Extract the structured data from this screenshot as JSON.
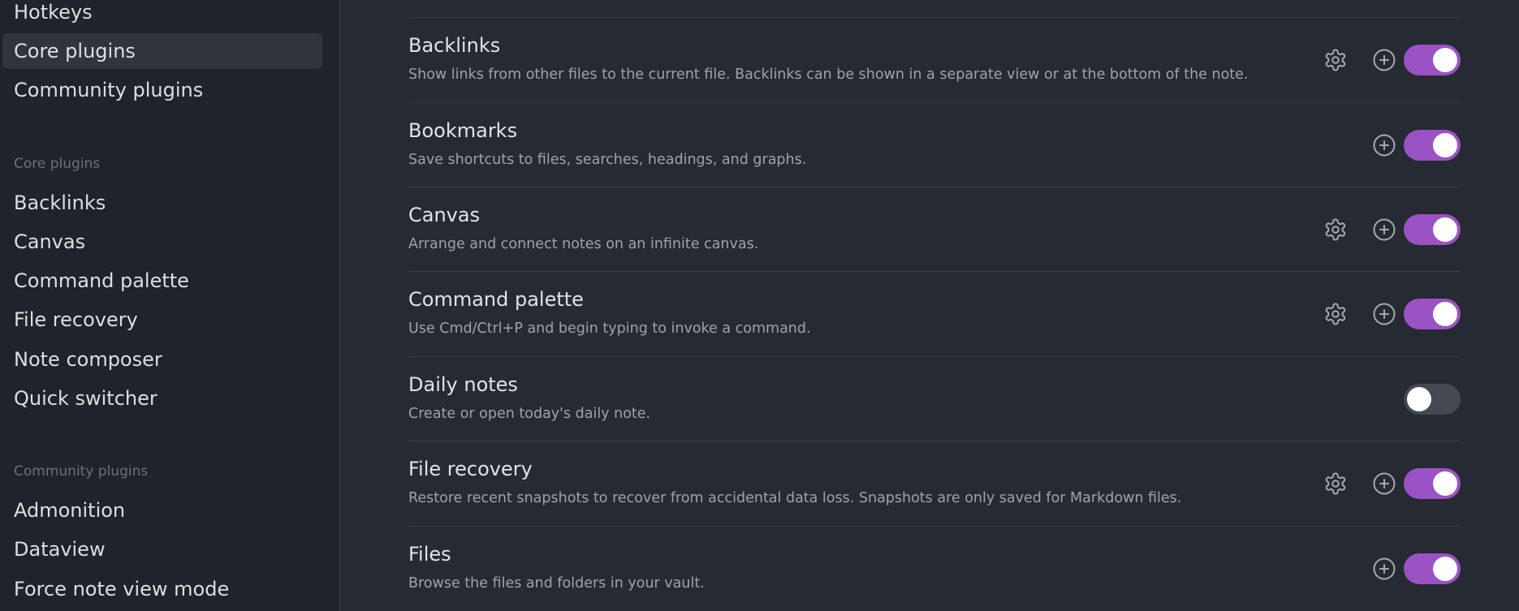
{
  "sidebar": {
    "options_items": [
      {
        "label": "Hotkeys"
      },
      {
        "label": "Core plugins",
        "active": true
      },
      {
        "label": "Community plugins"
      }
    ],
    "core_heading": "Core plugins",
    "core_items": [
      {
        "label": "Backlinks"
      },
      {
        "label": "Canvas"
      },
      {
        "label": "Command palette"
      },
      {
        "label": "File recovery"
      },
      {
        "label": "Note composer"
      },
      {
        "label": "Quick switcher"
      }
    ],
    "community_heading": "Community plugins",
    "community_items": [
      {
        "label": "Admonition"
      },
      {
        "label": "Dataview"
      },
      {
        "label": "Force note view mode"
      }
    ]
  },
  "plugins": [
    {
      "name": "Backlinks",
      "description": "Show links from other files to the current file. Backlinks can be shown in a separate view or at the bottom of the note.",
      "has_settings": true,
      "has_hotkey": true,
      "enabled": true
    },
    {
      "name": "Bookmarks",
      "description": "Save shortcuts to files, searches, headings, and graphs.",
      "has_settings": false,
      "has_hotkey": true,
      "enabled": true
    },
    {
      "name": "Canvas",
      "description": "Arrange and connect notes on an infinite canvas.",
      "has_settings": true,
      "has_hotkey": true,
      "enabled": true
    },
    {
      "name": "Command palette",
      "description": "Use Cmd/Ctrl+P and begin typing to invoke a command.",
      "has_settings": true,
      "has_hotkey": true,
      "enabled": true
    },
    {
      "name": "Daily notes",
      "description": "Create or open today's daily note.",
      "has_settings": false,
      "has_hotkey": false,
      "enabled": false
    },
    {
      "name": "File recovery",
      "description": "Restore recent snapshots to recover from accidental data loss. Snapshots are only saved for Markdown files.",
      "has_settings": true,
      "has_hotkey": true,
      "enabled": true
    },
    {
      "name": "Files",
      "description": "Browse the files and folders in your vault.",
      "has_settings": false,
      "has_hotkey": true,
      "enabled": true
    }
  ],
  "icons": {
    "settings": "gear-icon",
    "hotkey": "plus-circle-icon"
  },
  "colors": {
    "toggle_on": "#9b52c4",
    "toggle_off": "#454951",
    "sidebar_bg": "#1f232b",
    "main_bg": "#262a33"
  }
}
